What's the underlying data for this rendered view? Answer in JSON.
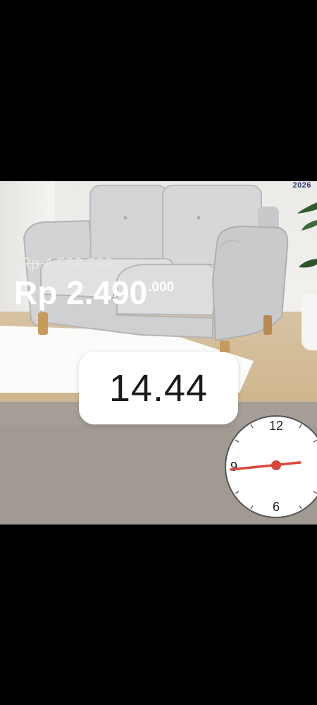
{
  "overlay": {
    "timer_text": "14.44"
  },
  "product_image": {
    "subject": "sofa",
    "corner_tag": "2026"
  },
  "pricing": {
    "old_price": "Rp 4.580.000",
    "new_price_main": "Rp 2.490",
    "new_price_sup": ".000"
  },
  "clock": {
    "label_12": "12",
    "label_9": "9",
    "label_6": "6",
    "hour_hand_color": "#d9473a"
  },
  "colors": {
    "panel": "#a59f97",
    "accent": "#d9473a"
  }
}
